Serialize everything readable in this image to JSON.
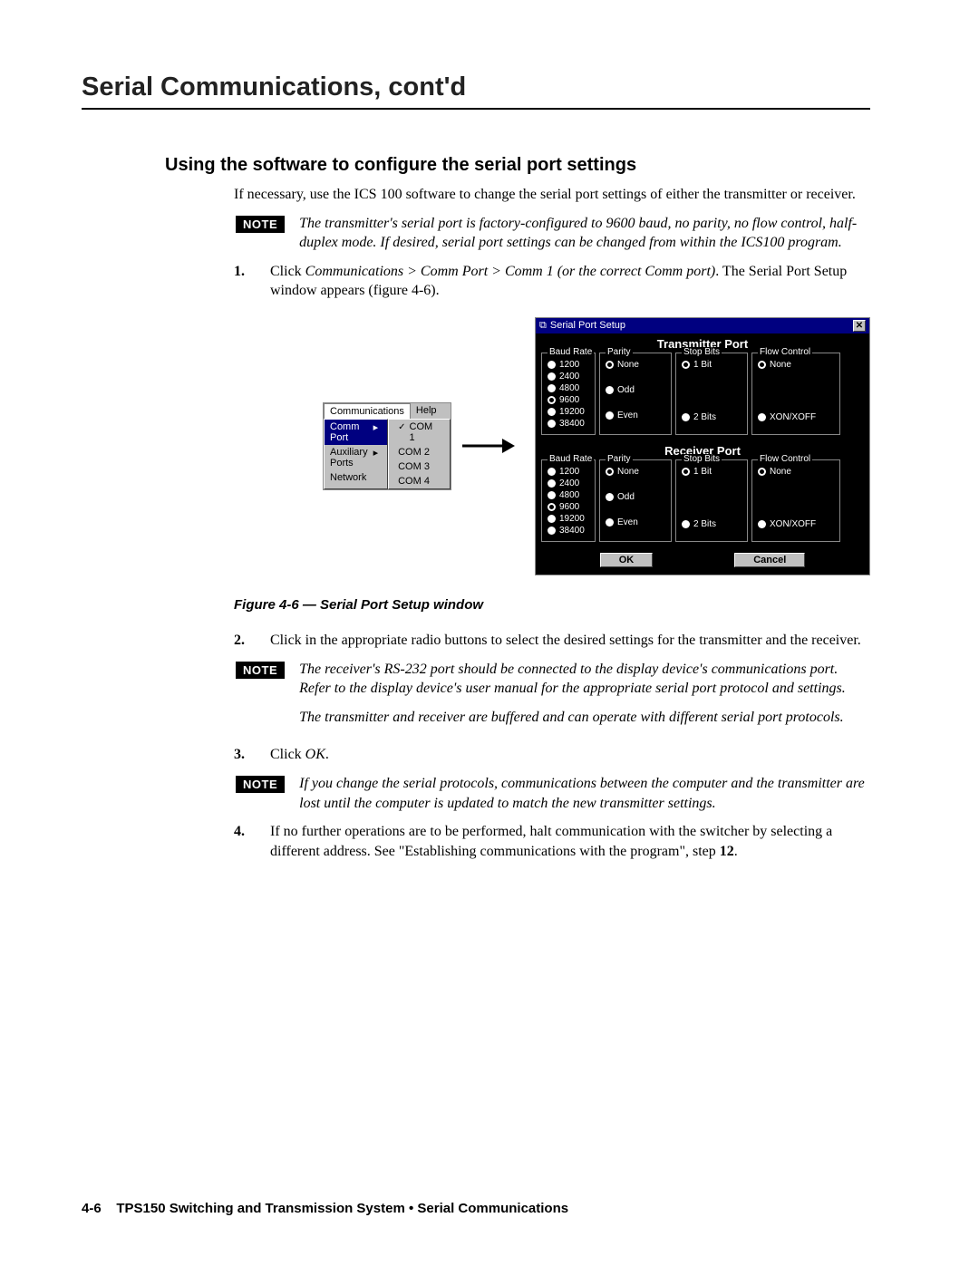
{
  "page": {
    "title": "Serial Communications, cont'd",
    "section_heading": "Using the software to configure the serial port settings",
    "intro": "If necessary, use the ICS 100 software to change the serial port settings of either the transmitter or receiver.",
    "note_label": "NOTE",
    "note1": "The transmitter's serial port is factory-configured to 9600 baud, no parity, no flow control, half-duplex mode.  If desired, serial port settings can be changed from within the ICS100 program.",
    "step1_num": "1.",
    "step1_a": "Click ",
    "step1_i": "Communications > Comm Port > Comm 1 (or the correct Comm port)",
    "step1_b": ".  The Serial Port Setup window appears (figure 4-6).",
    "figure_caption": "Figure 4-6 — Serial Port Setup window",
    "step2_num": "2.",
    "step2": "Click in the appropriate radio buttons to select the desired settings for the transmitter and the receiver.",
    "note2a": "The receiver's RS-232 port should be connected to the display device's communications port.  Refer to the display device's user manual for the appropriate serial port protocol and settings.",
    "note2b": "The transmitter and receiver are buffered and can operate with different serial port protocols.",
    "step3_num": "3.",
    "step3_a": "Click ",
    "step3_i": "OK",
    "step3_b": ".",
    "note3": "If you change the serial protocols, communications between the computer and the transmitter are lost until the computer is updated to match the new transmitter settings.",
    "step4_num": "4.",
    "step4_a": "If no further operations are to be performed, halt communication with the switcher by selecting a different address.  See \"Establishing communications with the program\", step ",
    "step4_b": "12",
    "step4_c": ".",
    "footer_num": "4-6",
    "footer_text": "TPS150 Switching and Transmission System • Serial Communications"
  },
  "menu": {
    "bar": [
      "Communications",
      "Help"
    ],
    "items": [
      {
        "label": "Comm Port",
        "arrow": "▸",
        "hi": true
      },
      {
        "label": "Auxiliary Ports",
        "arrow": "▸"
      },
      {
        "label": "Network",
        "arrow": ""
      }
    ],
    "sub": [
      "COM 1",
      "COM 2",
      "COM 3",
      "COM 4"
    ]
  },
  "dialog": {
    "title": "Serial Port Setup",
    "close": "✕",
    "ports": [
      {
        "name": "Transmitter Port"
      },
      {
        "name": "Receiver Port"
      }
    ],
    "groups": {
      "baud": {
        "label": "Baud Rate",
        "opts": [
          "1200",
          "2400",
          "4800",
          "9600",
          "19200",
          "38400"
        ],
        "sel": "9600"
      },
      "parity": {
        "label": "Parity",
        "opts": [
          "None",
          "Odd",
          "Even"
        ],
        "sel": "None"
      },
      "stop": {
        "label": "Stop Bits",
        "opts": [
          "1 Bit",
          "2 Bits"
        ],
        "sel": "1 Bit"
      },
      "flow": {
        "label": "Flow Control",
        "opts": [
          "None",
          "XON/XOFF"
        ],
        "sel": "None"
      }
    },
    "buttons": {
      "ok": "OK",
      "cancel": "Cancel"
    }
  }
}
